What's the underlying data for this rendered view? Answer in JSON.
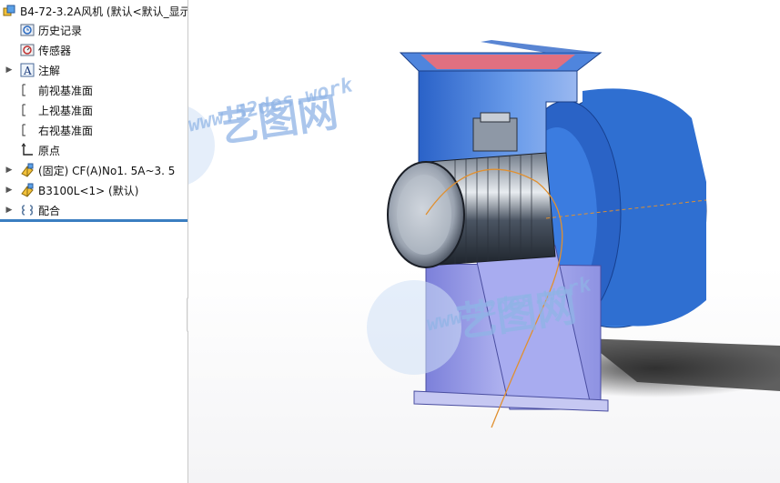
{
  "tree": {
    "root_label": "B4-72-3.2A风机 (默认<默认_显示",
    "items": [
      {
        "label": "历史记录",
        "icon": "history-folder-icon",
        "arrow": false
      },
      {
        "label": "传感器",
        "icon": "sensor-icon",
        "arrow": false
      },
      {
        "label": "注解",
        "icon": "annotation-icon",
        "arrow": true
      },
      {
        "label": "前视基准面",
        "icon": "plane-icon",
        "arrow": false
      },
      {
        "label": "上视基准面",
        "icon": "plane-icon",
        "arrow": false
      },
      {
        "label": "右视基准面",
        "icon": "plane-icon",
        "arrow": false
      },
      {
        "label": "原点",
        "icon": "origin-icon",
        "arrow": false
      },
      {
        "label": "(固定) CF(A)No1. 5A~3. 5",
        "icon": "part-icon",
        "arrow": true
      },
      {
        "label": "B3100L<1> (默认)",
        "icon": "part-icon",
        "arrow": true
      },
      {
        "label": "配合",
        "icon": "mates-icon",
        "arrow": true
      }
    ]
  },
  "watermark": {
    "brand": "艺图网",
    "url": "www.52des.work"
  },
  "colors": {
    "fan_blue": "#2f6fd1",
    "stand": "#9a9ee8",
    "motor": "#3c4654",
    "separator": "#3a7ec1",
    "watermark": "#8fb4e6"
  }
}
